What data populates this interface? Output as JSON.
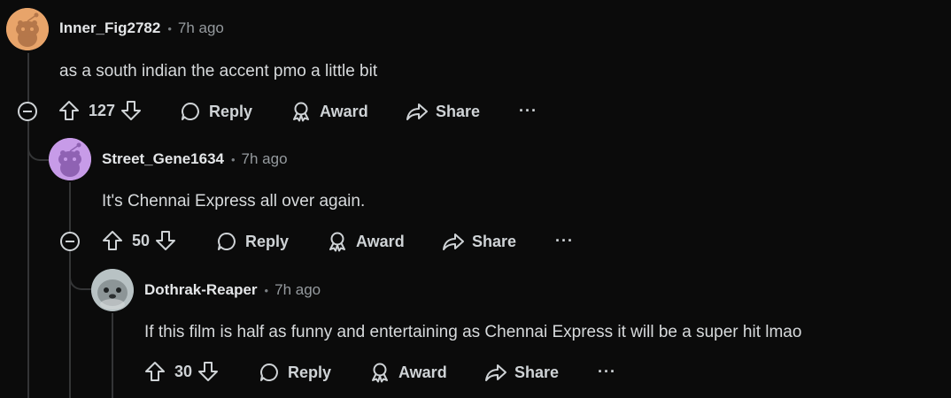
{
  "comments": [
    {
      "username": "Inner_Fig2782",
      "time": "7h ago",
      "body": "as a south indian the accent pmo a little bit",
      "score": "127",
      "reply_label": "Reply",
      "award_label": "Award",
      "share_label": "Share",
      "more_label": "···",
      "avatar_color": "#e8a46a"
    },
    {
      "username": "Street_Gene1634",
      "time": "7h ago",
      "body": "It's Chennai Express all over again.",
      "score": "50",
      "reply_label": "Reply",
      "award_label": "Award",
      "share_label": "Share",
      "more_label": "···",
      "avatar_color": "#c79be8"
    },
    {
      "username": "Dothrak-Reaper",
      "time": "7h ago",
      "body": "If this film is half as funny and entertaining as Chennai Express it will be a super hit lmao",
      "score": "30",
      "reply_label": "Reply",
      "award_label": "Award",
      "share_label": "Share",
      "more_label": "···",
      "avatar_color": "#9aa6a8"
    }
  ],
  "meta_separator": "•"
}
